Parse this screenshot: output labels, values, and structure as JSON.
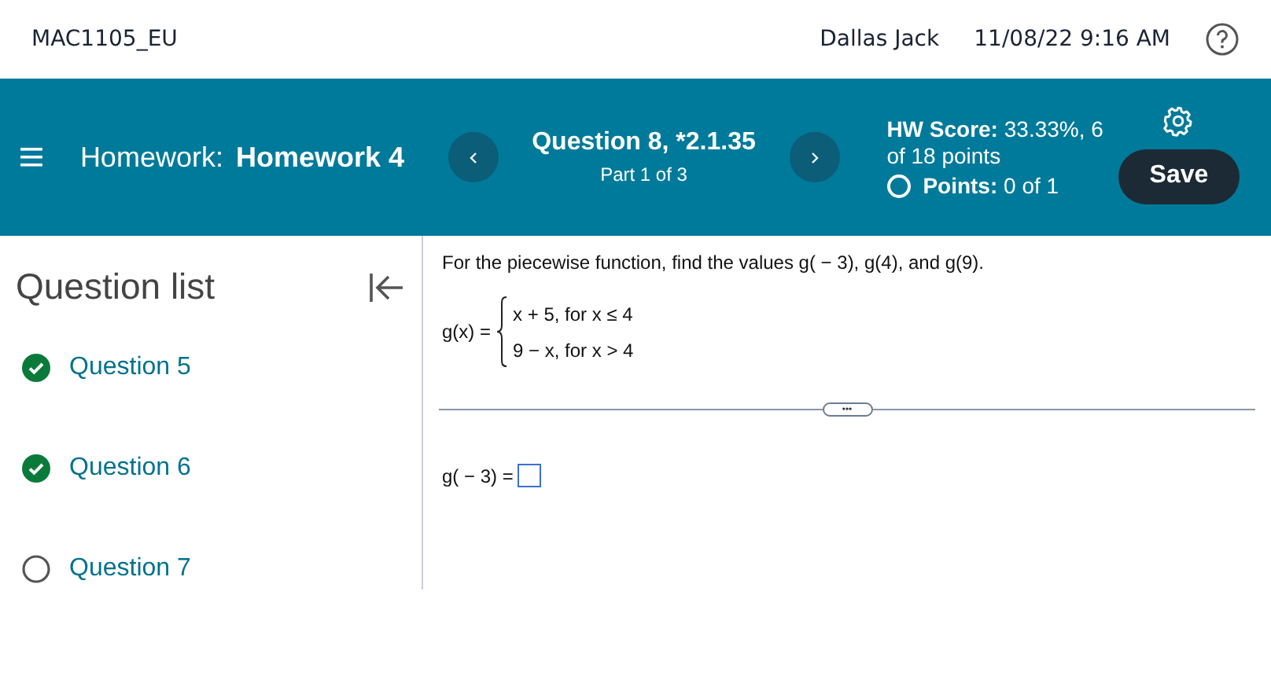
{
  "header": {
    "course": "MAC1105_EU",
    "user": "Dallas Jack",
    "datetime": "11/08/22 9:16 AM"
  },
  "toolbar": {
    "homework_label": "Homework:",
    "homework_name": "Homework 4",
    "question_title": "Question 8, *2.1.35",
    "question_part": "Part 1 of 3",
    "score_label": "HW Score:",
    "score_value": "33.33%, 6 of 18 points",
    "points_label": "Points:",
    "points_value": "0 of 1",
    "points_complete": false,
    "save_label": "Save"
  },
  "sidebar": {
    "title": "Question list",
    "items": [
      {
        "label": "Question 5",
        "completed": true
      },
      {
        "label": "Question 6",
        "completed": true
      },
      {
        "label": "Question 7",
        "completed": false
      }
    ]
  },
  "question": {
    "prompt": "For the piecewise function, find the values g( − 3), g(4), and g(9).",
    "function_lhs": "g(x) =",
    "cases": [
      "x + 5, for x ≤ 4",
      "9 − x, for x > 4"
    ],
    "more_label": "•••",
    "answer_label": "g( − 3) ="
  }
}
